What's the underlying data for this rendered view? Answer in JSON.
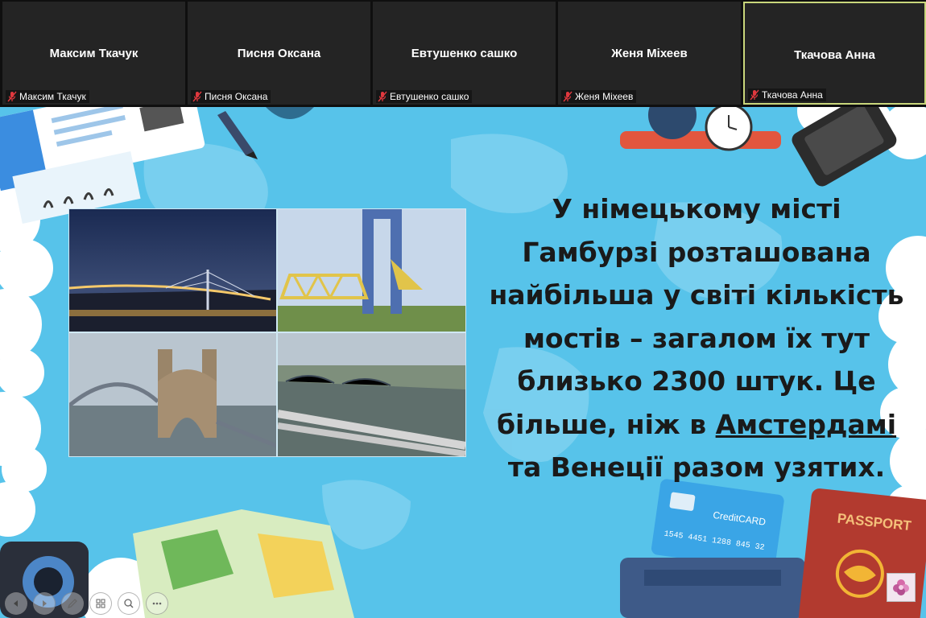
{
  "participants": [
    {
      "name": "Максим Ткачук",
      "tag": "Максим Ткачук",
      "muted": true
    },
    {
      "name": "Писня Оксана",
      "tag": "Писня Оксана",
      "muted": true
    },
    {
      "name": "Евтушенко сашко",
      "tag": "Евтушенко сашко",
      "muted": true
    },
    {
      "name": "Женя Міхеев",
      "tag": "Женя Міхеев",
      "muted": true
    },
    {
      "name": "Ткачова Анна",
      "tag": "Ткачова Анна",
      "muted": true,
      "active_speaker": true
    }
  ],
  "slide": {
    "lines": [
      "У німецькому місті",
      "Гамбурзі розташована",
      "найбільша у світі кількість",
      "мостів – загалом їх тут",
      "близько 2300 штук. Це"
    ],
    "line6_before": "більше, ніж в ",
    "line6_link": "Амстердамі",
    "line7": "та Венеції разом узятих.",
    "credit_card_label": "CreditCARD",
    "credit_card_number": "1545 4451 1288 845 32",
    "passport_label": "PASSPORT",
    "photos": [
      "hamburg-bridge-night",
      "lift-bridge",
      "old-elbe-bridge",
      "aerial-bridges"
    ]
  },
  "controls": [
    "previous-icon",
    "next-icon",
    "pen-icon",
    "slides-grid-icon",
    "zoom-icon",
    "more-icon"
  ],
  "colors": {
    "slide_background": "#57c3ea",
    "active_speaker_border": "#c9d67b",
    "muted_mic": "#e0383e"
  }
}
